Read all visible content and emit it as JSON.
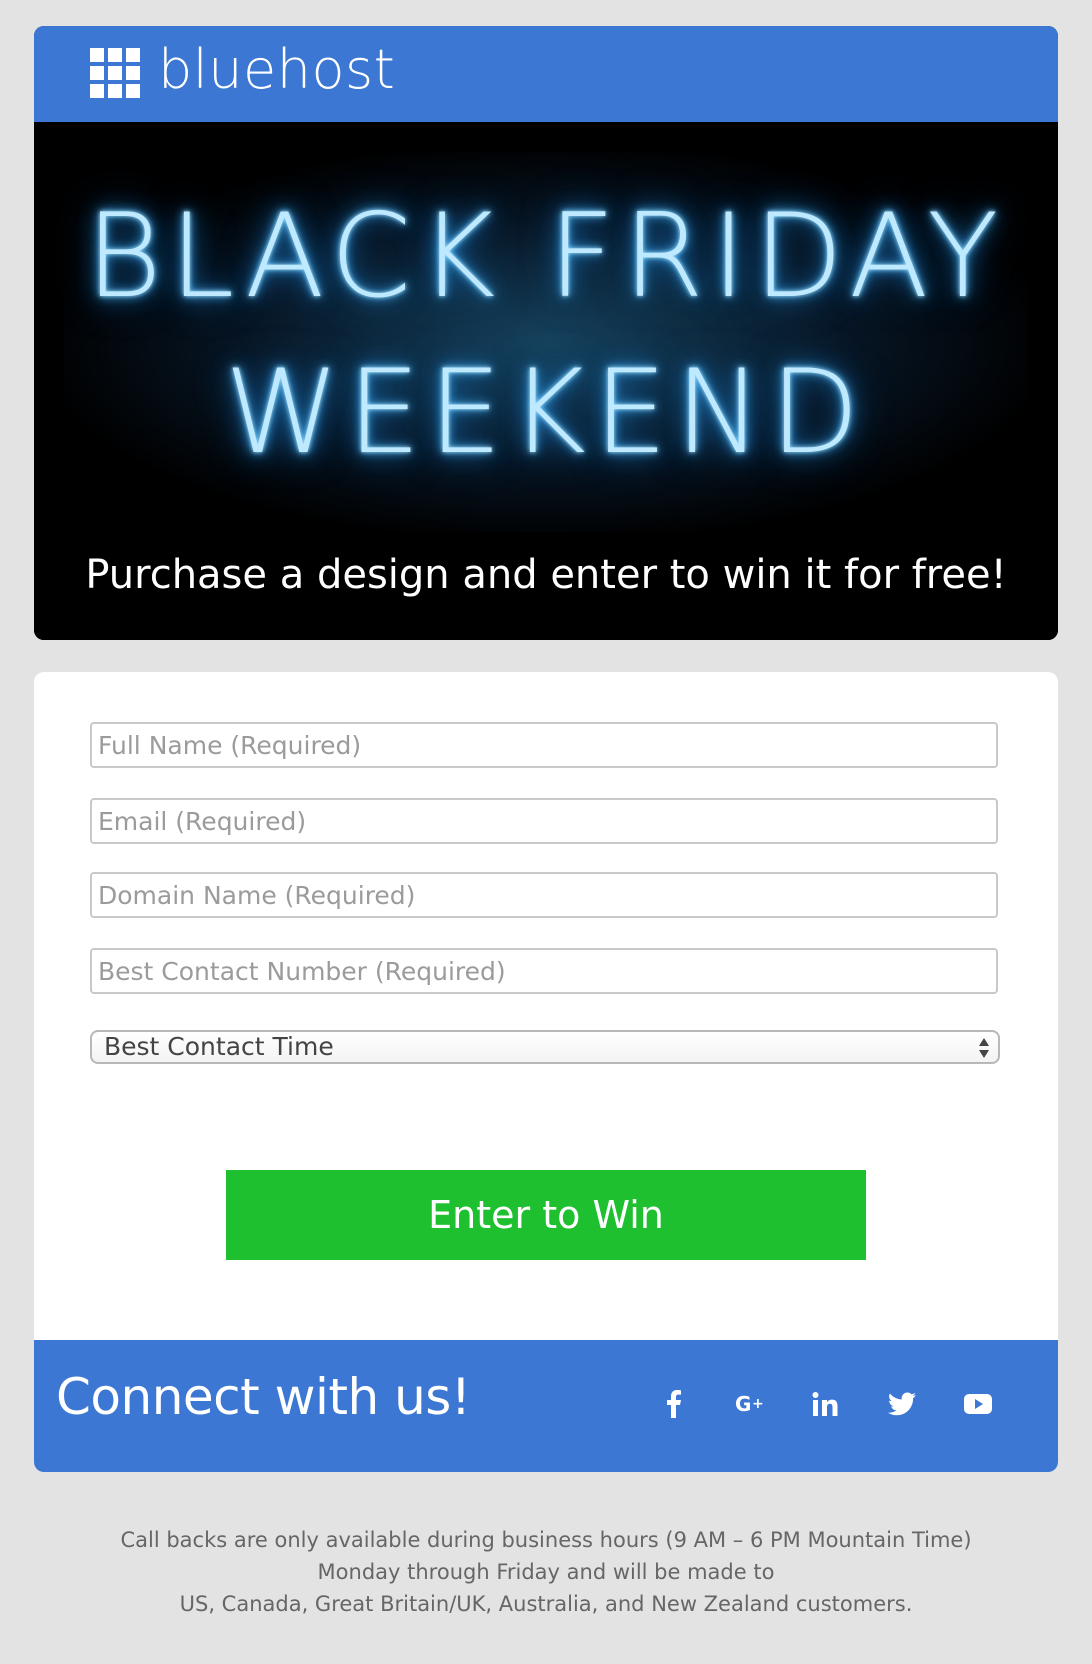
{
  "brand": {
    "name": "bluehost",
    "color": "#3b77d3"
  },
  "hero": {
    "line1": "BLACK FRIDAY",
    "line2": "WEEKEND",
    "subtitle": "Purchase a design and enter to win it for free!"
  },
  "form": {
    "full_name": {
      "placeholder": "Full Name (Required)",
      "value": ""
    },
    "email": {
      "placeholder": "Email (Required)",
      "value": ""
    },
    "domain": {
      "placeholder": "Domain Name (Required)",
      "value": ""
    },
    "phone": {
      "placeholder": "Best Contact Number (Required)",
      "value": ""
    },
    "contact_time": {
      "selected": "Best Contact Time"
    },
    "submit_label": "Enter to Win",
    "submit_color": "#1fc030"
  },
  "connect": {
    "title": "Connect with us!",
    "icons": [
      "facebook-icon",
      "google-plus-icon",
      "linkedin-icon",
      "twitter-icon",
      "youtube-icon"
    ]
  },
  "footer": {
    "line1": "Call backs are only available during business hours (9 AM – 6 PM Mountain Time)",
    "line2": "Monday through Friday and will be made to",
    "line3": "US, Canada, Great Britain/UK, Australia, and New Zealand customers."
  }
}
